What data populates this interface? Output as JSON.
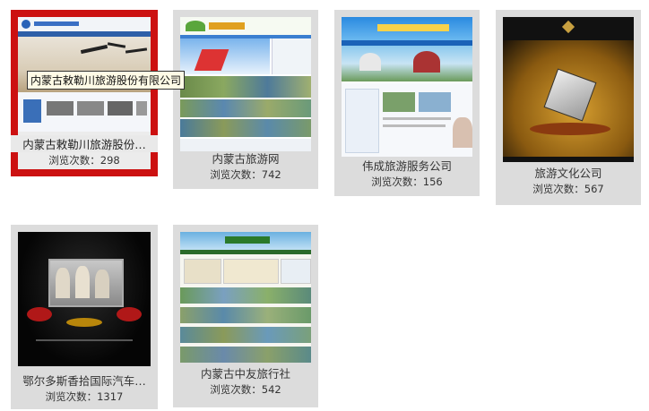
{
  "tooltip": "内蒙古敕勒川旅游股份有限公司",
  "cards": [
    {
      "title": "内蒙古敕勒川旅游股份…",
      "views": "浏览次数：298"
    },
    {
      "title": "内蒙古旅游网",
      "views": "浏览次数：742"
    },
    {
      "title": "伟成旅游服务公司",
      "views": "浏览次数：156"
    },
    {
      "title": "旅游文化公司",
      "views": "浏览次数：567"
    },
    {
      "title": "鄂尔多斯香拾国际汽车…",
      "views": "浏览次数：1317"
    },
    {
      "title": "内蒙古中友旅行社",
      "views": "浏览次数：542"
    }
  ],
  "colors": {
    "selected_border": "#cc1111",
    "card_bg": "#dcdcdc"
  }
}
